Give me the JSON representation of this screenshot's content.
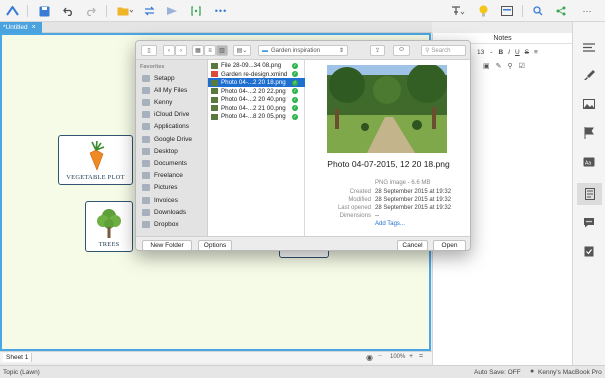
{
  "canvas": {
    "tab_label": "*Untitled",
    "tab_close": "×",
    "topics": [
      {
        "label": "VEGETABLE PLOT",
        "icon": "carrot-icon"
      },
      {
        "label": "TREES",
        "icon": "tree-icon"
      }
    ]
  },
  "notes": {
    "title": "Notes",
    "font_size": "13",
    "format_buttons": [
      "B",
      "I",
      "U",
      "S"
    ]
  },
  "sheet": {
    "tab_label": "Sheet 1",
    "zoom": "100%"
  },
  "status": {
    "topic": "Topic (Lawn)",
    "autosave": "Auto Save: OFF",
    "user": "Kenny's MacBook Pro"
  },
  "dialog": {
    "folder": "Garden inspiration",
    "search_placeholder": "Search",
    "favorites_title": "Favorites",
    "favorites": [
      "Setapp",
      "All My Files",
      "Kenny",
      "iCloud Drive",
      "Applications",
      "Google Drive",
      "Desktop",
      "Documents",
      "Freelance",
      "Pictures",
      "Invoices",
      "Downloads",
      "Dropbox"
    ],
    "files": [
      {
        "name": "File 28-09...34 08.png",
        "type": "png",
        "selected": false
      },
      {
        "name": "Garden re-design.xmind",
        "type": "xmind",
        "selected": false
      },
      {
        "name": "Photo 04-...2 20 18.png",
        "type": "png",
        "selected": true
      },
      {
        "name": "Photo 04-...2 20 22.png",
        "type": "png",
        "selected": false
      },
      {
        "name": "Photo 04-...2 20 40.png",
        "type": "png",
        "selected": false
      },
      {
        "name": "Photo 04-...2 21 00.png",
        "type": "png",
        "selected": false
      },
      {
        "name": "Photo 04-...8 20 05.png",
        "type": "png",
        "selected": false
      }
    ],
    "preview": {
      "filename": "Photo 04-07-2015, 12 20 18.png",
      "kind": "PNG image - 6.6 MB",
      "created_label": "Created",
      "created": "28 September 2015 at 19:32",
      "modified_label": "Modified",
      "modified": "28 September 2015 at 19:32",
      "last_opened_label": "Last opened",
      "last_opened": "28 September 2015 at 19:32",
      "dimensions_label": "Dimensions",
      "dimensions": "--",
      "add_tags": "Add Tags..."
    },
    "new_folder": "New Folder",
    "options": "Options",
    "cancel": "Cancel",
    "open": "Open"
  },
  "colors": {
    "accent": "#3a7bd5",
    "selection": "#1f6fd1",
    "canvas_bg": "#f6fbe7",
    "topic_border": "#2f5572"
  }
}
